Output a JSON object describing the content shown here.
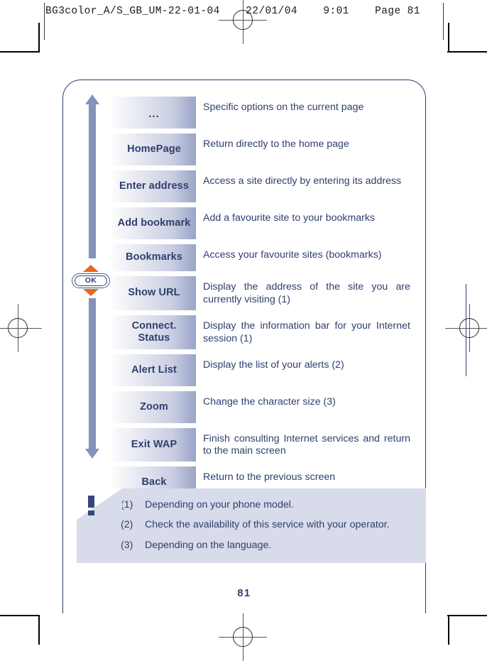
{
  "print_header": {
    "text": "BG3color_A/S_GB_UM-22-01-04    22/01/04    9:01    Page 81"
  },
  "nav": {
    "scroll_up_icon": "arrow-up",
    "scroll_down_icon": "arrow-down",
    "ok_key_label": "OK",
    "ok_up_icon": "triangle-up",
    "ok_down_icon": "triangle-down"
  },
  "menu": {
    "rows": [
      {
        "key": "...",
        "desc": "Specific options on the current page",
        "height": "tall",
        "justify": false
      },
      {
        "key": "HomePage",
        "desc": "Return directly to the home page",
        "height": "tall",
        "justify": false
      },
      {
        "key": "Enter address",
        "desc": "Access a site directly by entering its address",
        "height": "tall",
        "justify": true
      },
      {
        "key": "Add bookmark",
        "desc": "Add a favourite site to your bookmarks",
        "height": "tall",
        "justify": false
      },
      {
        "key": "Bookmarks",
        "desc": "Access your favourite sites (bookmarks)",
        "height": "short",
        "justify": false
      },
      {
        "key": "Show URL",
        "desc": "Display the address of the site you are currently visiting (1)",
        "height": "tall",
        "justify": true
      },
      {
        "key": "Connect. Status",
        "desc": "Display the information bar for your Internet session (1)",
        "height": "tall",
        "justify": true
      },
      {
        "key": "Alert List",
        "desc": "Display the list of your alerts (2)",
        "height": "tall",
        "justify": false
      },
      {
        "key": "Zoom",
        "desc": "Change the character size (3)",
        "height": "tall",
        "justify": false
      },
      {
        "key": "Exit WAP",
        "desc": "Finish consulting Internet services and return to the main screen",
        "height": "tall",
        "justify": true
      },
      {
        "key": "Back",
        "desc": "Return to the previous screen",
        "height": "tall",
        "justify": false
      }
    ]
  },
  "notes": {
    "warning_icon": "exclamation-mark",
    "items": [
      {
        "num": "(1)",
        "text": "Depending on your phone model."
      },
      {
        "num": "(2)",
        "text": "Check the availability of this service with your operator."
      },
      {
        "num": "(3)",
        "text": "Depending on the language."
      }
    ]
  },
  "footer": {
    "page_number": "81"
  },
  "colors": {
    "ink_blue": "#2f3f6e",
    "bar_blue": "#8691bc",
    "accent_orange": "#e8671c",
    "note_bg": "#d7dbea",
    "frame_border": "#2c3d6e"
  }
}
